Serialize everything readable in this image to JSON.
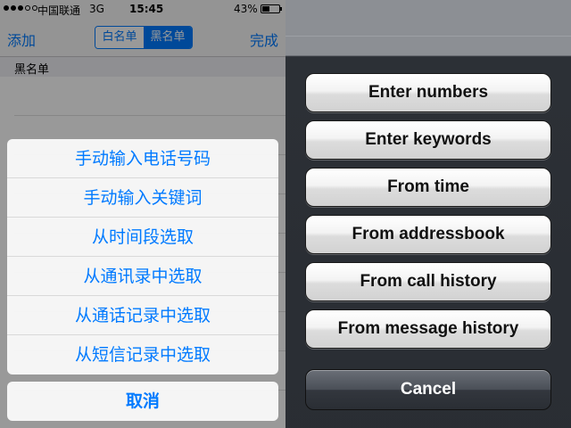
{
  "left": {
    "status_bar": {
      "carrier": "中国联通",
      "network": "3G",
      "time": "15:45",
      "battery": "43%",
      "battery_level": 0.43,
      "signal_filled": 3,
      "signal_total": 5
    },
    "nav": {
      "left_label": "添加",
      "right_label": "完成",
      "segments": [
        "白名单",
        "黑名单"
      ],
      "selected_segment": "黑名单"
    },
    "section_header": "黑名单",
    "action_sheet": {
      "options": [
        "手动输入电话号码",
        "手动输入关键词",
        "从时间段选取",
        "从通讯录中选取",
        "从通话记录中选取",
        "从短信记录中选取"
      ],
      "cancel": "取消"
    },
    "accent_color": "#007aff"
  },
  "right": {
    "action_sheet": {
      "options": [
        "Enter numbers",
        "Enter keywords",
        "From time",
        "From addressbook",
        "From call history",
        "From message history"
      ],
      "cancel": "Cancel"
    }
  }
}
